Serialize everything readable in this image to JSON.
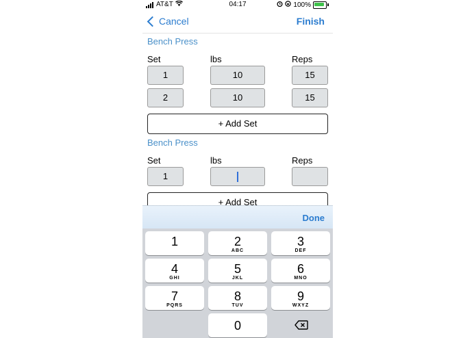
{
  "status_bar": {
    "carrier": "AT&T",
    "time": "04:17",
    "battery": "100%"
  },
  "nav": {
    "cancel_label": "Cancel",
    "finish_label": "Finish"
  },
  "exercises": [
    {
      "title": "Bench Press",
      "headers": {
        "set": "Set",
        "lbs": "lbs",
        "reps": "Reps"
      },
      "rows": [
        {
          "set": "1",
          "lbs": "10",
          "reps": "15"
        },
        {
          "set": "2",
          "lbs": "10",
          "reps": "15"
        }
      ],
      "add_label": "+ Add Set"
    },
    {
      "title": "Bench Press",
      "headers": {
        "set": "Set",
        "lbs": "lbs",
        "reps": "Reps"
      },
      "rows": [
        {
          "set": "1",
          "lbs": "",
          "reps": ""
        }
      ],
      "add_label": "+ Add Set"
    }
  ],
  "keyboard": {
    "done_label": "Done",
    "keys": [
      {
        "num": "1",
        "letters": ""
      },
      {
        "num": "2",
        "letters": "ABC"
      },
      {
        "num": "3",
        "letters": "DEF"
      },
      {
        "num": "4",
        "letters": "GHI"
      },
      {
        "num": "5",
        "letters": "JKL"
      },
      {
        "num": "6",
        "letters": "MNO"
      },
      {
        "num": "7",
        "letters": "PQRS"
      },
      {
        "num": "8",
        "letters": "TUV"
      },
      {
        "num": "9",
        "letters": "WXYZ"
      },
      {
        "num": "0",
        "letters": ""
      }
    ],
    "delete_icon": "backspace-icon"
  },
  "colors": {
    "accent": "#2b7ccf",
    "section_title": "#4a90c9",
    "cell_bg": "#dfe2e4",
    "keyboard_bg": "#d1d4d9"
  }
}
